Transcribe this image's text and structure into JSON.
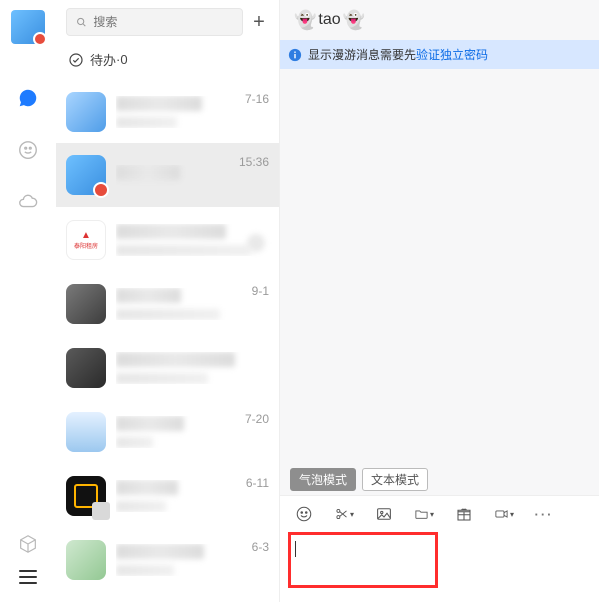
{
  "rail": {
    "icons": [
      "chat",
      "contacts",
      "cloud",
      "cube",
      "menu"
    ]
  },
  "search": {
    "placeholder": "搜索"
  },
  "pending": {
    "label": "待办",
    "count": "0",
    "sep": " · "
  },
  "chats": [
    {
      "time": "7-16"
    },
    {
      "time": "15:36",
      "selected": true
    },
    {
      "time": ""
    },
    {
      "time": "9-1"
    },
    {
      "time": ""
    },
    {
      "time": "7-20"
    },
    {
      "time": "6-11"
    },
    {
      "time": "6-3"
    }
  ],
  "pane": {
    "title": "tao",
    "info_prefix": "显示漫游消息需要先",
    "info_link": "验证独立密码",
    "mode_bubble": "气泡模式",
    "mode_text": "文本模式",
    "toolbar": [
      "emoji",
      "scissors",
      "image",
      "folder",
      "gift",
      "record",
      "more"
    ]
  }
}
